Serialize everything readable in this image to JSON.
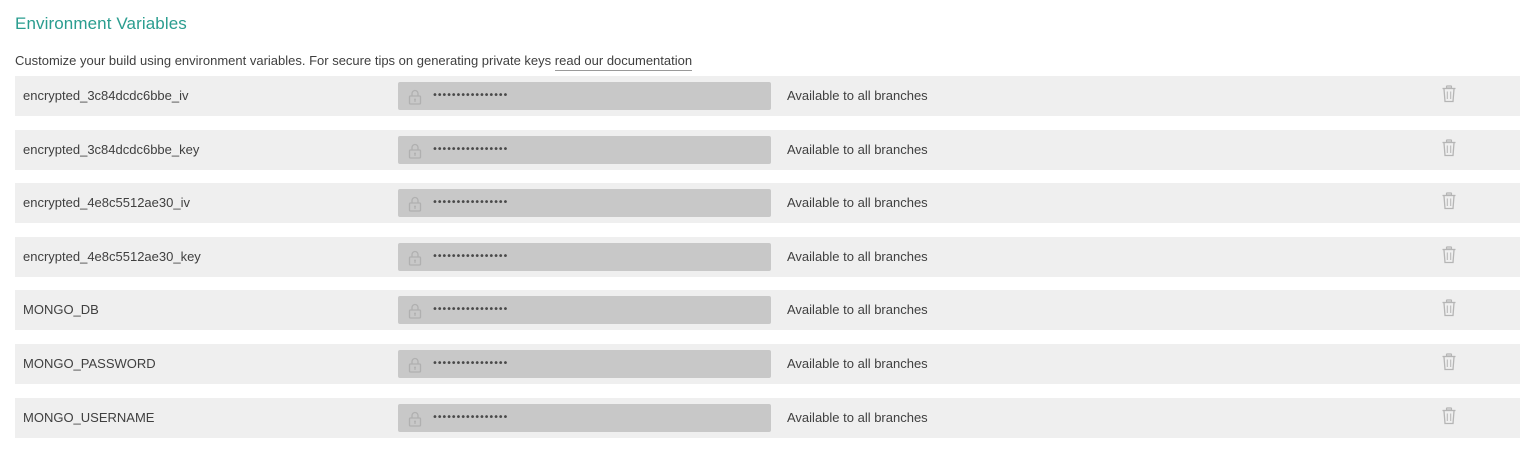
{
  "section": {
    "title": "Environment Variables",
    "description": "Customize your build using environment variables. For secure tips on generating private keys ",
    "doc_link": "read our documentation"
  },
  "variables": [
    {
      "name": "encrypted_3c84dcdc6bbe_iv",
      "value": "••••••••••••••••",
      "scope": "Available to all branches"
    },
    {
      "name": "encrypted_3c84dcdc6bbe_key",
      "value": "••••••••••••••••",
      "scope": "Available to all branches"
    },
    {
      "name": "encrypted_4e8c5512ae30_iv",
      "value": "••••••••••••••••",
      "scope": "Available to all branches"
    },
    {
      "name": "encrypted_4e8c5512ae30_key",
      "value": "••••••••••••••••",
      "scope": "Available to all branches"
    },
    {
      "name": "MONGO_DB",
      "value": "••••••••••••••••",
      "scope": "Available to all branches"
    },
    {
      "name": "MONGO_PASSWORD",
      "value": "••••••••••••••••",
      "scope": "Available to all branches"
    },
    {
      "name": "MONGO_USERNAME",
      "value": "••••••••••••••••",
      "scope": "Available to all branches"
    }
  ],
  "icons": {
    "lock": "lock-icon",
    "delete": "trash-icon"
  },
  "colors": {
    "title": "#2a9d8f",
    "row_background": "#efefef",
    "value_background": "#c8c8c8",
    "icon": "#b5b5b5"
  }
}
